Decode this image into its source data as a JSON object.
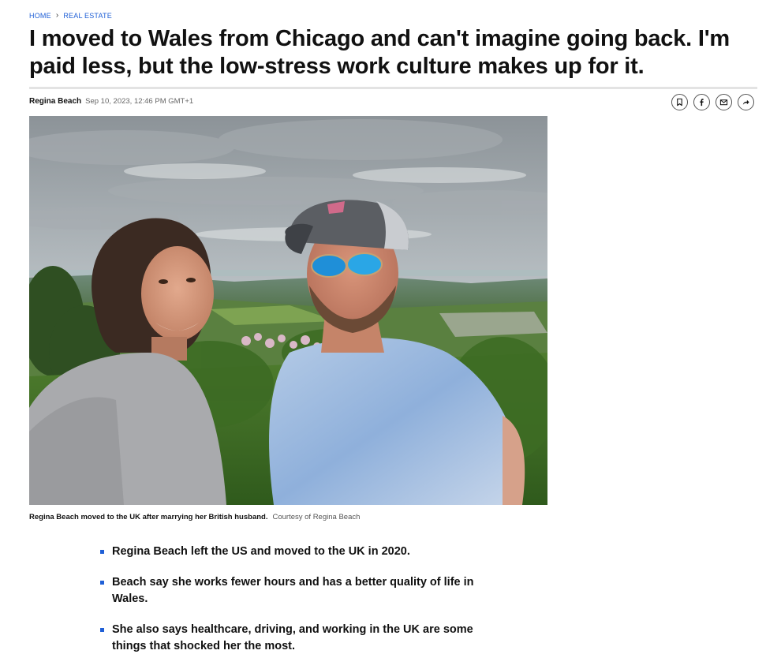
{
  "breadcrumb": {
    "home": "HOME",
    "separator": "›",
    "section": "REAL ESTATE"
  },
  "headline": "I moved to Wales from Chicago and can't imagine going back. I'm paid less, but the low-stress work culture makes up for it.",
  "byline": {
    "author": "Regina Beach",
    "date": "Sep 10, 2023, 12:46 PM GMT+1"
  },
  "share_icons": [
    "bookmark-icon",
    "facebook-icon",
    "email-icon",
    "share-icon"
  ],
  "photo": {
    "subject": "selfie"
  },
  "caption": {
    "text": "Regina Beach moved to the UK after marrying her British husband.",
    "credit": "Courtesy of Regina Beach"
  },
  "key_points": [
    "Regina Beach left the US and moved to the UK in 2020.",
    "Beach say she works fewer hours and has a better quality of life in Wales.",
    "She also says healthcare, driving, and working in the UK are some things that shocked her the most."
  ],
  "colors": {
    "link": "#1f5fd6",
    "text": "#111111",
    "rule": "#e3e3e3"
  }
}
